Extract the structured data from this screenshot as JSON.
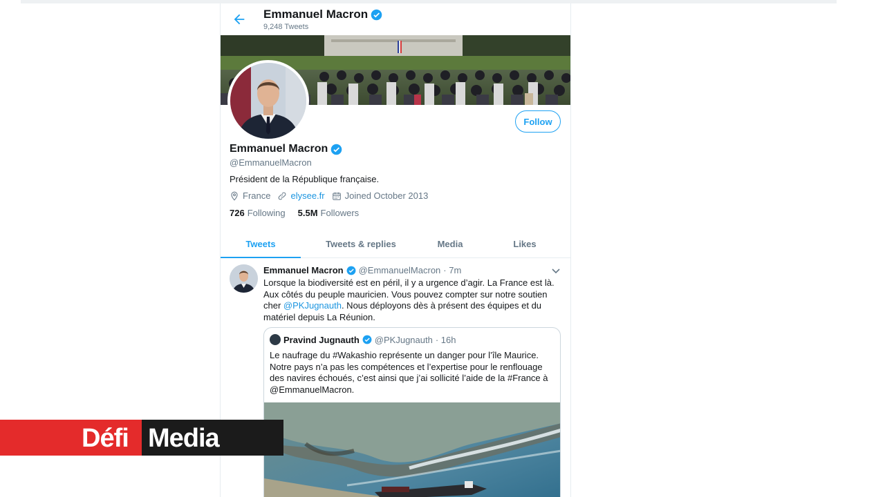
{
  "header": {
    "name": "Emmanuel Macron",
    "tweet_count": "9,248 Tweets"
  },
  "profile": {
    "name": "Emmanuel Macron",
    "handle": "@EmmanuelMacron",
    "bio": "Président de la République française.",
    "location": "France",
    "website": "elysee.fr",
    "joined": "Joined October 2013",
    "following_count": "726",
    "following_label": "Following",
    "followers_count": "5.5M",
    "followers_label": "Followers",
    "follow_label": "Follow"
  },
  "tabs": [
    {
      "label": "Tweets",
      "active": true
    },
    {
      "label": "Tweets & replies",
      "active": false
    },
    {
      "label": "Media",
      "active": false
    },
    {
      "label": "Likes",
      "active": false
    }
  ],
  "tweet": {
    "name": "Emmanuel Macron",
    "handle": "@EmmanuelMacron",
    "time": "· 7m",
    "text_1": "Lorsque la biodiversité est en péril, il y a urgence d’agir. La France est là. Aux côtés du peuple mauricien. Vous pouvez compter sur notre soutien cher",
    "mention": "@PKJugnauth",
    "text_2": ". Nous déployons dès à présent des équipes et du matériel depuis La Réunion."
  },
  "quoted": {
    "name": "Pravind Jugnauth",
    "handle": "@PKJugnauth",
    "time": "· 16h",
    "text": "Le naufrage du #Wakashio représente un danger pour l’île Maurice. Notre pays n’a pas les compétences et l’expertise pour le renflouage des navires échoués, c’est ainsi que j’ai sollicité l’aide de la #France à @EmmanuelMacron."
  },
  "logo": {
    "part1": "Défi",
    "part2": "Media"
  },
  "colors": {
    "accent": "#1da1f2",
    "link": "#1b95e0",
    "text": "#14171a",
    "muted": "#657786",
    "logo_red": "#e42b2b",
    "logo_dark": "#1b1b1b"
  },
  "icons": [
    "back-arrow-icon",
    "verified-badge-icon",
    "location-pin-icon",
    "link-icon",
    "calendar-icon",
    "chevron-down-icon"
  ]
}
